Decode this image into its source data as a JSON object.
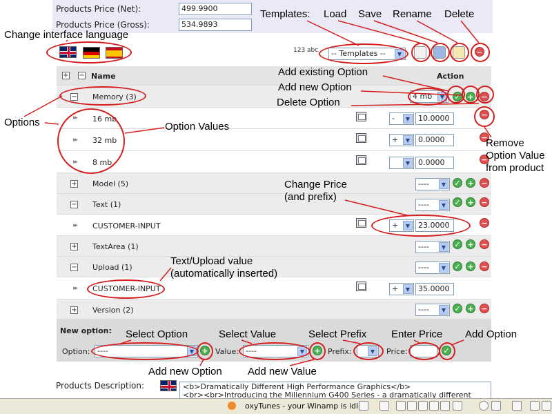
{
  "prices": {
    "net_label": "Products Price (Net):",
    "net_value": "499.9900",
    "gross_label": "Products Price (Gross):",
    "gross_value": "534.9893"
  },
  "annotations": {
    "change_language": "Change interface language",
    "templates": "Templates:",
    "load": "Load",
    "save": "Save",
    "rename": "Rename",
    "delete": "Delete",
    "add_existing_option": "Add existing Option",
    "add_new_option": "Add new Option",
    "delete_option": "Delete Option",
    "options": "Options",
    "option_values": "Option Values",
    "remove_option_value": "Remove\nOption Value\nfrom product",
    "change_price": "Change Price\n(and prefix)",
    "text_upload_value": "Text/Upload value\n(automatically inserted)",
    "select_option": "Select Option",
    "select_value": "Select Value",
    "select_prefix": "Select Prefix",
    "enter_price": "Enter Price",
    "add_option": "Add Option",
    "add_new_option_bottom": "Add new Option",
    "add_new_value": "Add new Value"
  },
  "toolbar": {
    "sort_label": "123 abc",
    "templates_select": "-- Templates --"
  },
  "table": {
    "header_name": "Name",
    "header_action": "Action",
    "rows": [
      {
        "kind": "group",
        "label": "Memory (3)",
        "expander": "−",
        "select": "4 mb"
      },
      {
        "kind": "value",
        "label": "16 mb",
        "prefix": "-",
        "price": "10.0000"
      },
      {
        "kind": "value",
        "label": "32 mb",
        "prefix": "+",
        "price": "0.0000"
      },
      {
        "kind": "value",
        "label": "8 mb",
        "prefix": "",
        "price": "0.0000"
      },
      {
        "kind": "group",
        "label": "Model (5)",
        "expander": "+",
        "select": "----"
      },
      {
        "kind": "group",
        "label": "Text (1)",
        "expander": "−",
        "select": "----"
      },
      {
        "kind": "value",
        "label": "CUSTOMER-INPUT",
        "prefix": "+",
        "price": "23.0000"
      },
      {
        "kind": "group",
        "label": "TextArea (1)",
        "expander": "+",
        "select": "----"
      },
      {
        "kind": "group",
        "label": "Upload (1)",
        "expander": "−",
        "select": "----"
      },
      {
        "kind": "value",
        "label": "CUSTOMER-INPUT",
        "prefix": "+",
        "price": "35.0000"
      },
      {
        "kind": "group",
        "label": "Version (2)",
        "expander": "+",
        "select": "----"
      }
    ]
  },
  "new_option": {
    "title": "New option:",
    "option_label": "Option:",
    "option_value": "----",
    "value_label": "Value:",
    "value_value": "----",
    "prefix_label": "Prefix:",
    "prefix_value": "",
    "price_label": "Price:",
    "price_value": ""
  },
  "description": {
    "label": "Products Description:",
    "line1": "<b>Dramatically Different High Performance Graphics</b>",
    "line2": "<br><br>Introducing the Millennium G400 Series - a dramatically different"
  },
  "taskbar": {
    "player_text": "oxyTunes - your Winamp is idle"
  },
  "colors": {
    "annotation_red": "#d41e1e",
    "add_green": "#4caf50",
    "delete_red": "#e05050",
    "price_block_bg": "#e9eaf5",
    "group_row_bg": "#ececec"
  }
}
